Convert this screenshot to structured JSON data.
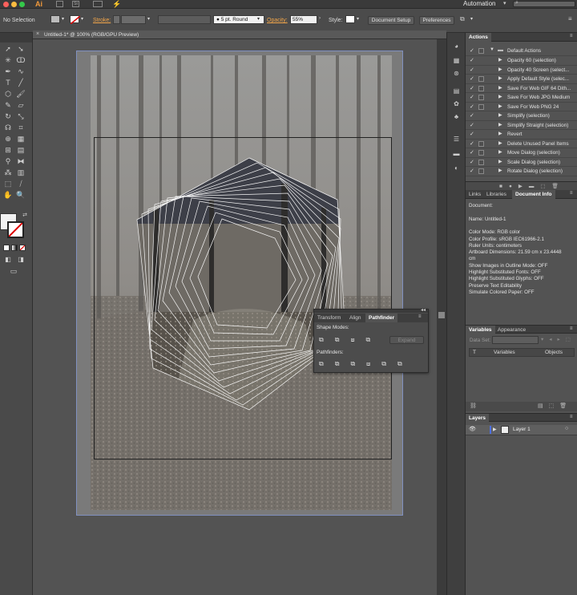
{
  "app": {
    "logo": "Ai",
    "workspace": "Automation",
    "search_placeholder": ""
  },
  "controlbar": {
    "selection": "No Selection",
    "stroke_label": "Stroke:",
    "brush": "5 pt. Round",
    "opacity_label": "Opacity:",
    "opacity_value": "55%",
    "style_label": "Style:",
    "document_setup": "Document Setup",
    "preferences": "Preferences"
  },
  "document": {
    "tab_title": "Untitled-1* @ 100% (RGB/GPU Preview)",
    "close_glyph": "×"
  },
  "actions_panel": {
    "title": "Actions",
    "set_name": "Default Actions",
    "items": [
      "Opacity 60 (selection)",
      "Opacity 40 Screen (select...",
      "Apply Default Style (selec...",
      "Save For Web GIF 64 Dith...",
      "Save For Web JPG Medium",
      "Save For Web PNG 24",
      "Simplify (selection)",
      "Simplify Straight (selection)",
      "Revert",
      "Delete Unused Panel Items",
      "Move Dialog (selection)",
      "Scale Dialog (selection)",
      "Rotate Dialog (selection)"
    ]
  },
  "info_panel": {
    "tabs": [
      "Links",
      "Libraries",
      "Document Info"
    ],
    "lines": [
      "Document:",
      "",
      "Name: Untitled-1",
      "",
      "Color Mode: RGB color",
      "Color Profile: sRGB IEC61966-2.1",
      "Ruler Units: centimeters",
      "Artboard Dimensions: 21.59 cm x 23.4448",
      "cm",
      "Show Images in Outline Mode: OFF",
      "Highlight Substituted Fonts: OFF",
      "Highlight Substituted Glyphs: OFF",
      "Preserve Text Editability",
      "Simulate Colored Paper: OFF"
    ]
  },
  "variables_panel": {
    "tabs": [
      "Variables",
      "Appearance"
    ],
    "data_set_label": "Data Set:",
    "col_type": "T",
    "col_variables": "Variables",
    "col_objects": "Objects"
  },
  "layers_panel": {
    "title": "Layers",
    "layer_name": "Layer 1"
  },
  "pathfinder_panel": {
    "tabs": [
      "Transform",
      "Align",
      "Pathfinder"
    ],
    "shape_modes_label": "Shape Modes:",
    "expand_label": "Expand",
    "pathfinders_label": "Pathfinders:"
  },
  "colors": {
    "accent": "#4a7bd6",
    "layer_color": "#4d6fe0"
  }
}
